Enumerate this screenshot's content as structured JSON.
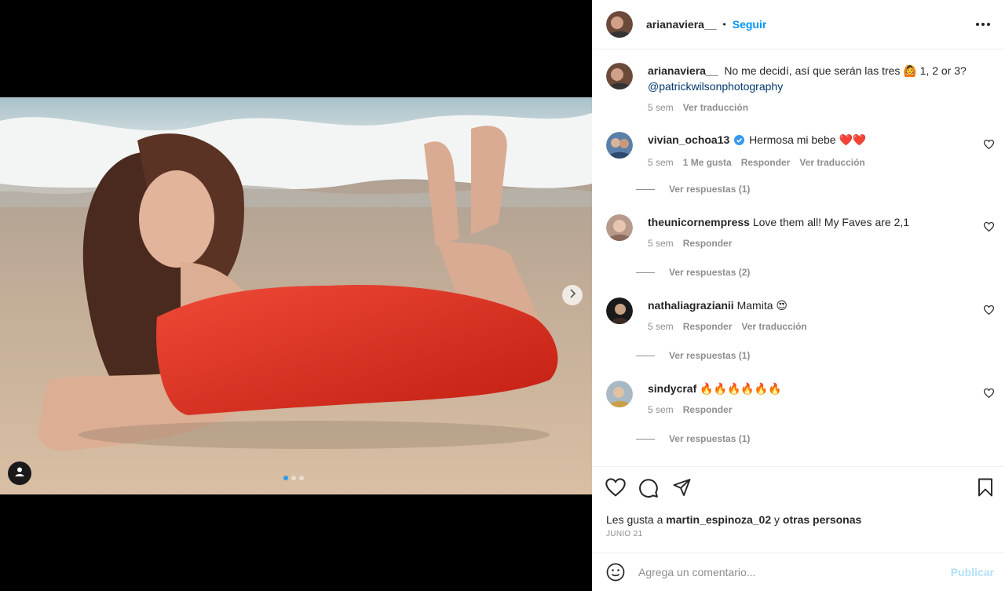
{
  "post": {
    "author": "arianaviera__",
    "follow_label": "Seguir",
    "separator": "•",
    "caption": {
      "user": "arianaviera__",
      "text": "No me decidí, así que serán las tres 🙆 1, 2 or 3?",
      "mention": "@patrickwilsonphotography",
      "time": "5 sem",
      "translate": "Ver traducción"
    },
    "carousel": {
      "slides": 3,
      "current": 1
    }
  },
  "comments": [
    {
      "user": "vivian_ochoa13",
      "verified": true,
      "text": "Hermosa mi bebe ❤️❤️",
      "time": "5 sem",
      "likes": "1 Me gusta",
      "reply": "Responder",
      "translate": "Ver traducción",
      "replies": "Ver respuestas (1)"
    },
    {
      "user": "theunicornempress",
      "verified": false,
      "text": "Love them all! My Faves are 2,1",
      "time": "5 sem",
      "reply": "Responder",
      "replies": "Ver respuestas (2)"
    },
    {
      "user": "nathaliagrazianii",
      "verified": false,
      "text": "Mamita 😍",
      "time": "5 sem",
      "reply": "Responder",
      "translate": "Ver traducción",
      "replies": "Ver respuestas (1)"
    },
    {
      "user": "sindycraf",
      "verified": false,
      "text": "🔥🔥🔥🔥🔥🔥",
      "time": "5 sem",
      "reply": "Responder",
      "replies": "Ver respuestas (1)"
    }
  ],
  "footer": {
    "likes_prefix": "Les gusta a",
    "likes_user": "martin_espinoza_02",
    "likes_mid": "y",
    "likes_suffix": "otras personas",
    "date": "JUNIO 21",
    "comment_placeholder": "Agrega un comentario...",
    "publish_label": "Publicar"
  },
  "icons": {
    "more": "more-options-icon",
    "like": "heart-icon",
    "comment": "comment-icon",
    "share": "share-icon",
    "save": "bookmark-icon",
    "emoji": "emoji-icon",
    "next": "chevron-right-icon",
    "tag": "user-tag-icon",
    "verified": "verified-badge-icon"
  },
  "colors": {
    "accent": "#0095f6",
    "verified": "#3897f0",
    "publish_disabled": "#b2dffc",
    "dress": "#d42a1c"
  }
}
